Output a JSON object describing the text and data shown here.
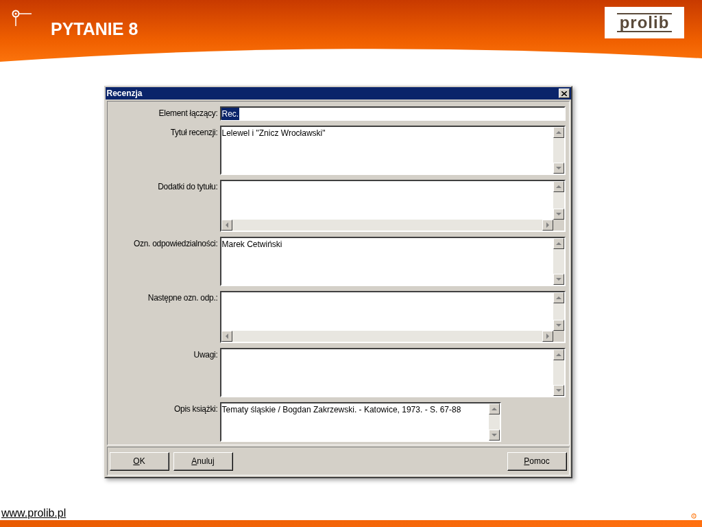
{
  "slide": {
    "title": "PYTANIE 8",
    "logo": "prolib",
    "footer_url": "www.prolib.pl"
  },
  "dialog": {
    "title": "Recenzja",
    "fields": [
      {
        "label": "Element łączący:",
        "kind": "line",
        "value": "Rec.",
        "value_selected": true
      },
      {
        "label": "Tytuł recenzji:",
        "kind": "memo",
        "value": "Lelewel i \"Znicz Wrocławski\""
      },
      {
        "label": "Dodatki do tytułu:",
        "kind": "memo_hscroll"
      },
      {
        "label": "Ozn. odpowiedzialności:",
        "kind": "memo",
        "value": "Marek Cetwiński"
      },
      {
        "label": "Następne ozn. odp.:",
        "kind": "memo_hscroll"
      },
      {
        "label": "Uwagi:",
        "kind": "memo"
      },
      {
        "label": "Opis książki:",
        "kind": "memo_narrow",
        "value": "Tematy śląskie / Bogdan Zakrzewski. - Katowice, 1973. - S. 67-88"
      }
    ],
    "left_buttons": [
      "OK",
      "Anuluj"
    ],
    "right_buttons": [
      "Pomoc"
    ]
  }
}
